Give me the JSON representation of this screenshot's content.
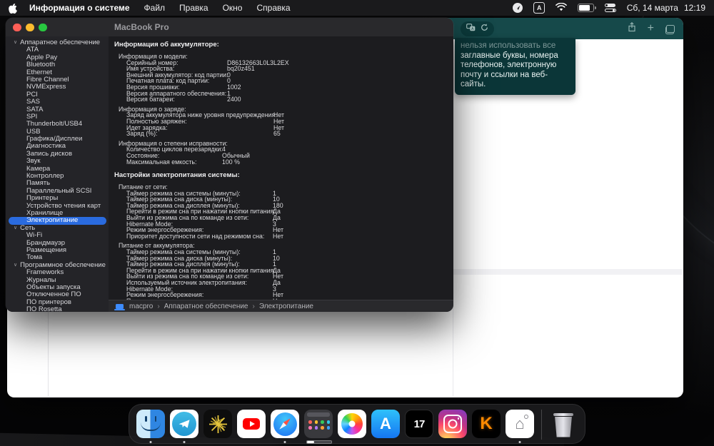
{
  "menu_bar": {
    "app_name": "Информация о системе",
    "menus": [
      "Файл",
      "Правка",
      "Окно",
      "Справка"
    ],
    "status": {
      "keyboard_layout": "А",
      "date": "Сб, 14 марта",
      "time": "12:19"
    }
  },
  "browser": {
    "tooltip_lines": [
      "нельзя использовать все",
      "заглавные буквы, номера",
      "телефонов, электронную",
      "почту и ссылки на веб-",
      "сайты."
    ],
    "toolbar_accent": "#16494a",
    "tooltip_bg": "#0b3638"
  },
  "window": {
    "title": "MacBook Pro",
    "sidebar": {
      "sections": [
        {
          "label": "Аппаратное обеспечение",
          "selected": "Электропитание",
          "items": [
            "ATA",
            "Apple Pay",
            "Bluetooth",
            "Ethernet",
            "Fibre Channel",
            "NVMExpress",
            "PCI",
            "SAS",
            "SATA",
            "SPI",
            "Thunderbolt/USB4",
            "USB",
            "Графика/Дисплеи",
            "Диагностика",
            "Запись дисков",
            "Звук",
            "Камера",
            "Контроллер",
            "Память",
            "Параллельный SCSI",
            "Принтеры",
            "Устройство чтения карт",
            "Хранилище",
            "Электропитание"
          ]
        },
        {
          "label": "Сеть",
          "selected": "",
          "items": [
            "Wi-Fi",
            "Брандмауэр",
            "Размещения",
            "Тома"
          ]
        },
        {
          "label": "Программное обеспечение",
          "selected": "",
          "items": [
            "Frameworks",
            "Журналы",
            "Объекты запуска",
            "Отключенное ПО",
            "ПО принтеров",
            "ПО Rosetta"
          ]
        }
      ]
    },
    "content": {
      "sections": [
        {
          "header": "Информация об аккумуляторе:",
          "groups": [
            {
              "title": "Информация о модели:",
              "value_x": 158,
              "rows": [
                [
                  "Серийный номер:",
                  "D86132663L0L3L2EX"
                ],
                [
                  "Имя устройства:",
                  "bq20z451"
                ],
                [
                  "Внешний аккумулятор: код партии:",
                  "0"
                ],
                [
                  "Печатная плата: код партии:",
                  "0"
                ],
                [
                  "Версия прошивки:",
                  "1002"
                ],
                [
                  "Версия аппаратного обеспечения:",
                  "1"
                ],
                [
                  "Версия батареи:",
                  "2400"
                ]
              ]
            },
            {
              "title": "Информация о заряде:",
              "value_x": 223,
              "rows": [
                [
                  "Заряд аккумулятора ниже уровня предупреждения:",
                  "Нет"
                ],
                [
                  "Полностью заряжен:",
                  "Нет"
                ],
                [
                  "Идет зарядка:",
                  "Нет"
                ],
                [
                  "Заряд (%):",
                  "65"
                ]
              ]
            },
            {
              "title": "Информация о степени исправности:",
              "value_x": 151,
              "rows": [
                [
                  "Количество циклов перезарядки:",
                  "4"
                ],
                [
                  "Состояние:",
                  "Обычный"
                ],
                [
                  "Максимальная емкость:",
                  "100 %"
                ]
              ]
            }
          ]
        },
        {
          "header": "Настройки электропитания системы:",
          "groups": [
            {
              "title": "Питание от сети:",
              "value_x": 222,
              "rows": [
                [
                  "Таймер режима сна системы (минуты):",
                  "1"
                ],
                [
                  "Таймер режима сна диска (минуты):",
                  "10"
                ],
                [
                  "Таймер режима сна дисплея (минуты):",
                  "180"
                ],
                [
                  "Перейти в режим сна при нажатии кнопки питания:",
                  "Да"
                ],
                [
                  "Выйти из режима сна по команде из сети:",
                  "Да"
                ],
                [
                  "Hibernate Mode:",
                  "3"
                ],
                [
                  "Режим энергосбережения:",
                  "Нет"
                ],
                [
                  "Приоритет доступности сети над режимом сна:",
                  "Нет"
                ]
              ]
            },
            {
              "title": "Питание от аккумулятора:",
              "value_x": 222,
              "rows": [
                [
                  "Таймер режима сна системы (минуты):",
                  "1"
                ],
                [
                  "Таймер режима сна диска (минуты):",
                  "10"
                ],
                [
                  "Таймер режима сна дисплея (минуты):",
                  "1"
                ],
                [
                  "Перейти в режим сна при нажатии кнопки питания:",
                  "Да"
                ],
                [
                  "Выйти из режима сна по команде из сети:",
                  "Нет"
                ],
                [
                  "Используемый источник электропитания:",
                  "Да"
                ],
                [
                  "Hibernate Mode:",
                  "3"
                ],
                [
                  "Режим энергосбережения:",
                  "Нет"
                ],
                [
                  "Приоритет доступности сети над режимом сна:",
                  "Нет"
                ]
              ]
            }
          ]
        }
      ]
    },
    "statusbar": {
      "device": "macpro",
      "separator": "›",
      "crumbs": [
        "Аппаратное обеспечение",
        "Электропитание"
      ]
    }
  },
  "dock": {
    "apps": [
      {
        "name": "finder",
        "running": true
      },
      {
        "name": "telegram",
        "running": true
      },
      {
        "name": "starburst-app",
        "running": false
      },
      {
        "name": "youtube",
        "running": false
      },
      {
        "name": "safari",
        "running": true
      },
      {
        "name": "app-grid",
        "running": false,
        "progress": 28
      },
      {
        "name": "photos",
        "running": false
      },
      {
        "name": "app-store",
        "running": false
      },
      {
        "name": "tradingview",
        "running": false
      },
      {
        "name": "instagram",
        "running": false
      },
      {
        "name": "k-app",
        "running": false
      },
      {
        "name": "home-design",
        "running": true
      },
      {
        "name": "trash",
        "running": false
      }
    ],
    "labels": {
      "app_store_glyph": "A",
      "tradingview_glyph": "17",
      "k_glyph": "K",
      "home_glyph": "⌂"
    }
  },
  "colors": {
    "selection_blue": "#2a6bdf",
    "menu_bg": "#1a1a1c",
    "window_bg": "#242428",
    "content_bg": "#1c1c1f"
  }
}
